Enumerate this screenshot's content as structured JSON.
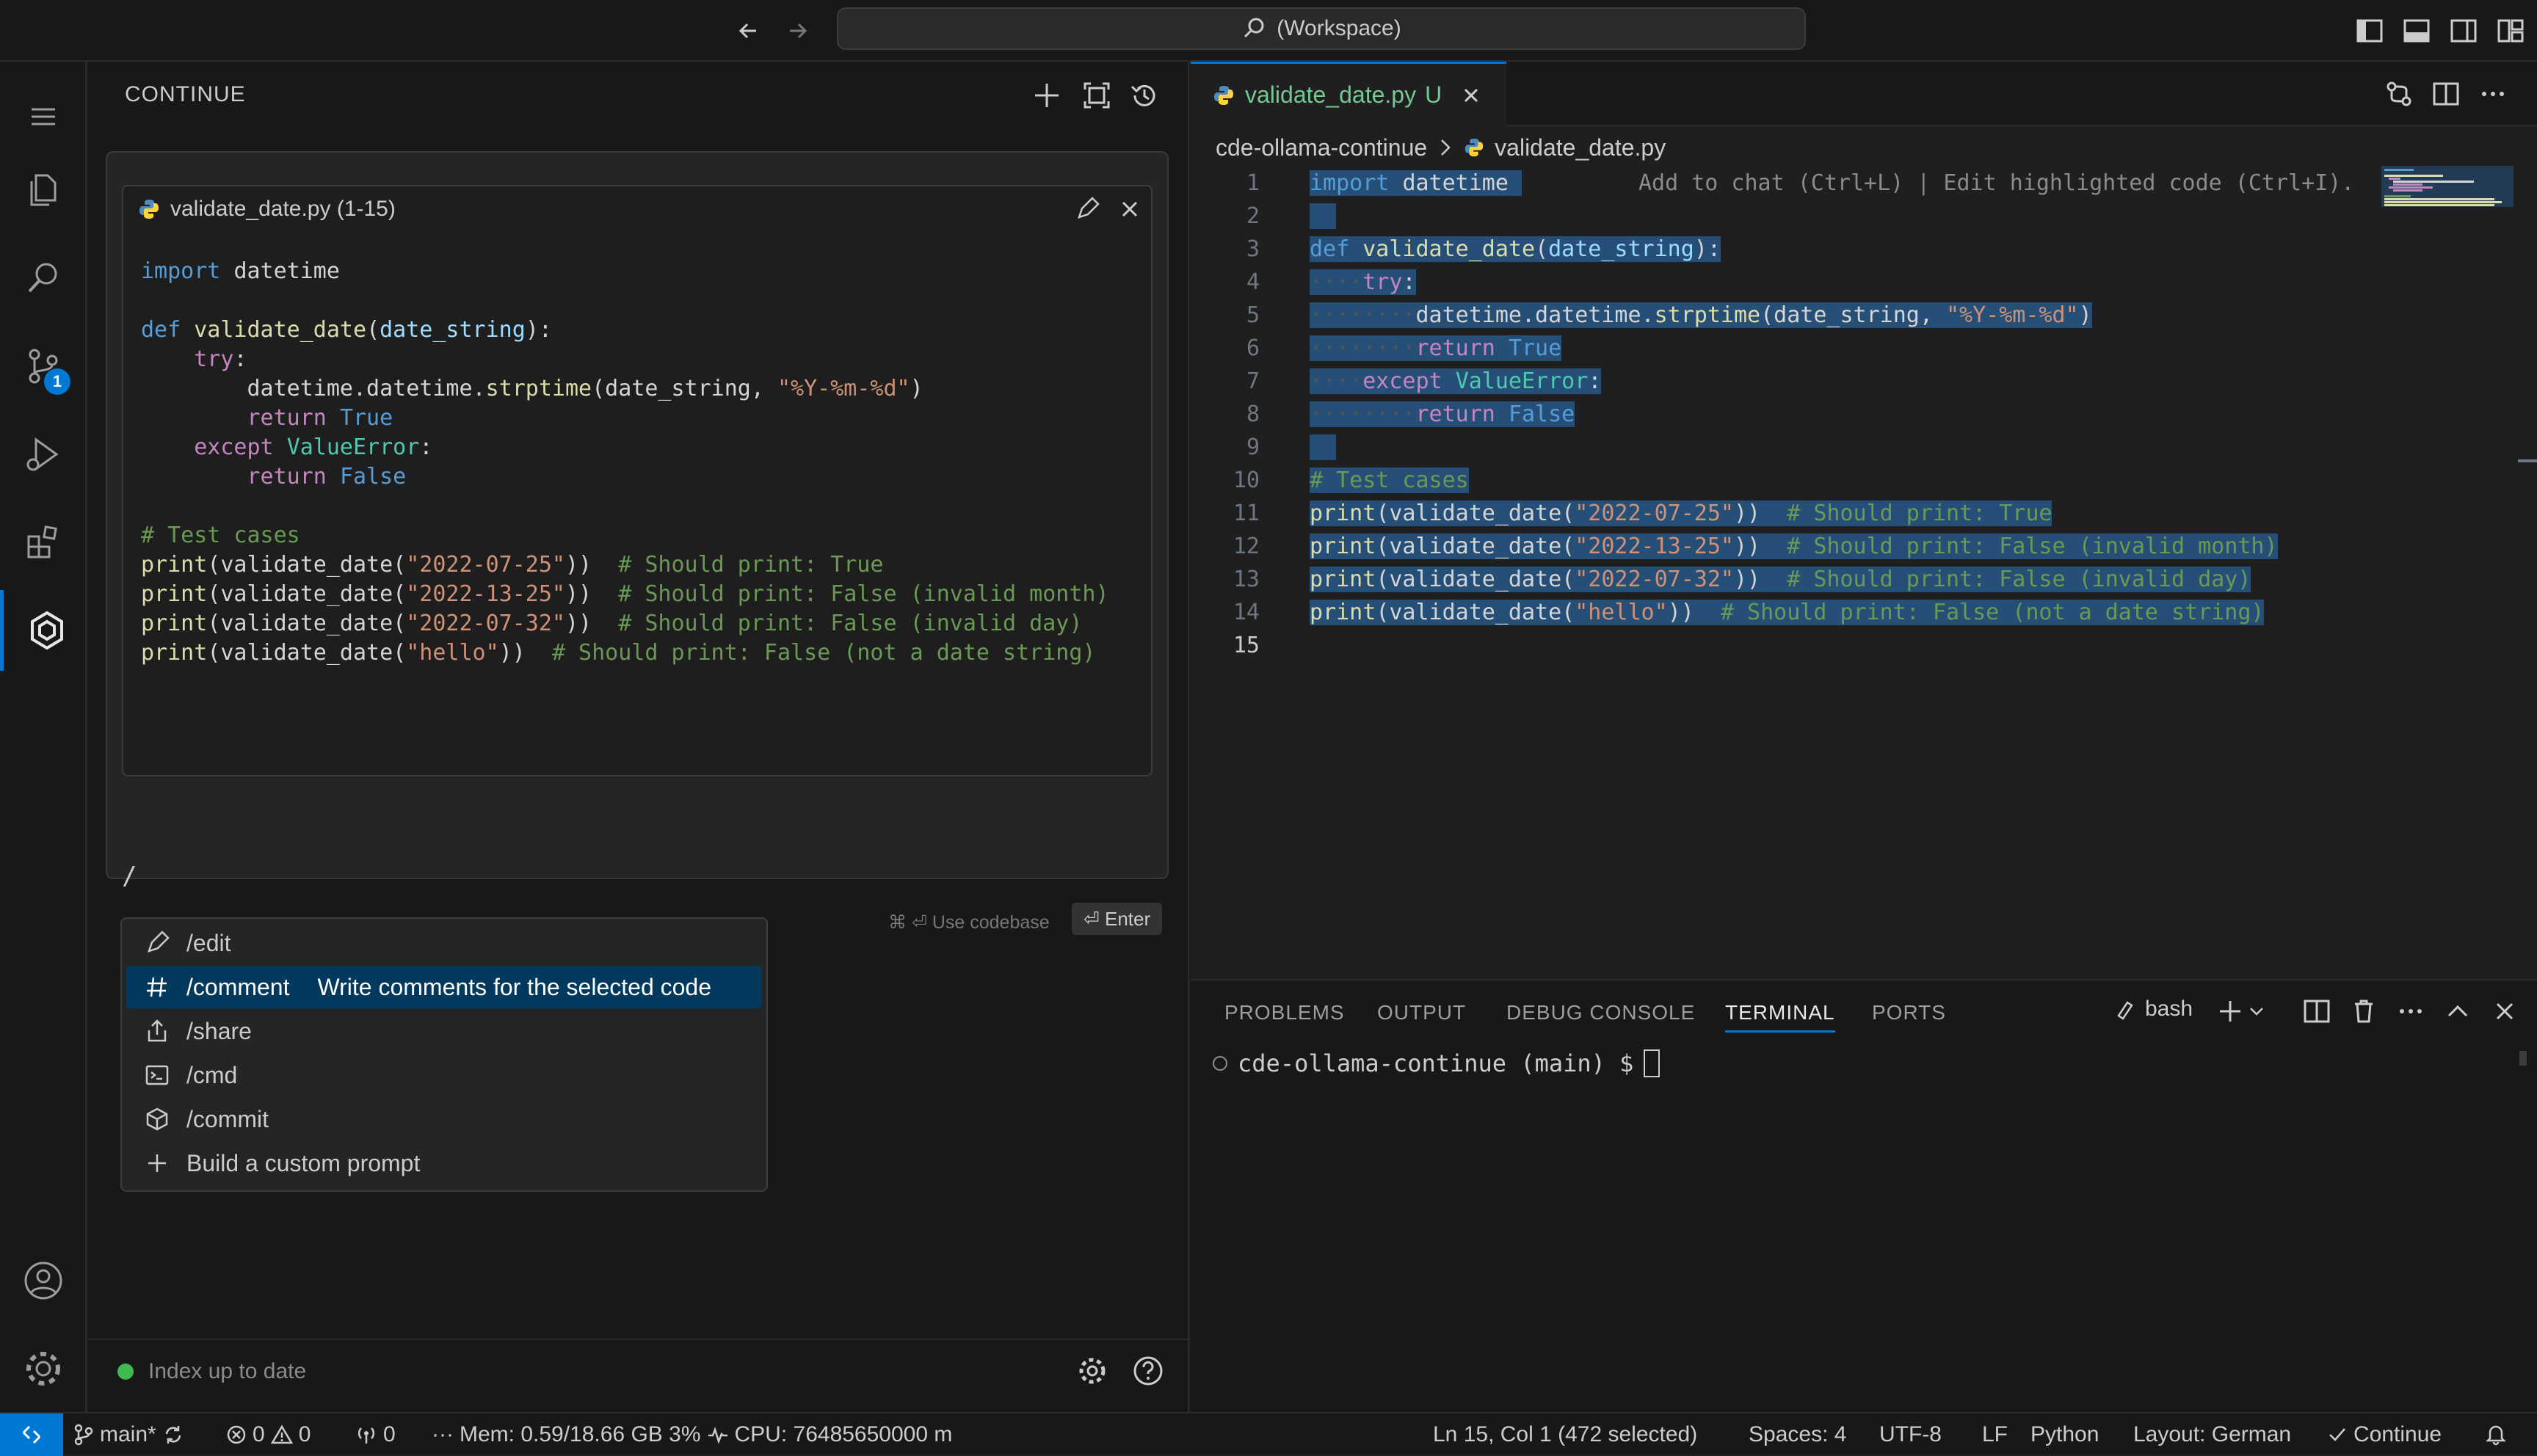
{
  "titlebar": {
    "search": "(Workspace)"
  },
  "activity": {
    "source_control_badge": "1"
  },
  "continue_panel": {
    "title": "CONTINUE",
    "context_file": "validate_date.py (1-15)",
    "typed_input": "/",
    "hint_codebase": "⌘ ⏎ Use codebase",
    "enter_label": "⏎ Enter",
    "slash_menu": [
      {
        "label": "/edit",
        "icon": "pencil-icon"
      },
      {
        "label": "/comment",
        "icon": "hash-icon",
        "description": "Write comments for the selected code"
      },
      {
        "label": "/share",
        "icon": "share-icon"
      },
      {
        "label": "/cmd",
        "icon": "terminal-icon"
      },
      {
        "label": "/commit",
        "icon": "cube-icon"
      },
      {
        "label": "Build a custom prompt",
        "icon": "plus-icon"
      }
    ],
    "footer_status": "Index up to date"
  },
  "code": {
    "lines": [
      "import datetime",
      "",
      "def validate_date(date_string):",
      "    try:",
      "        datetime.datetime.strptime(date_string, \"%Y-%m-%d\")",
      "        return True",
      "    except ValueError:",
      "        return False",
      "",
      "# Test cases",
      "print(validate_date(\"2022-07-25\"))  # Should print: True",
      "print(validate_date(\"2022-13-25\"))  # Should print: False (invalid month)",
      "print(validate_date(\"2022-07-32\"))  # Should print: False (invalid day)",
      "print(validate_date(\"hello\"))  # Should print: False (not a date string)",
      ""
    ],
    "inline_hint": "Add to chat (Ctrl+L) | Edit highlighted code (Ctrl+I)."
  },
  "editor": {
    "tab_label": "validate_date.py",
    "tab_status": "U",
    "breadcrumb_folder": "cde-ollama-continue",
    "breadcrumb_file": "validate_date.py",
    "line_numbers": [
      "1",
      "2",
      "3",
      "4",
      "5",
      "6",
      "7",
      "8",
      "9",
      "10",
      "11",
      "12",
      "13",
      "14",
      "15"
    ]
  },
  "panel": {
    "tabs": [
      "PROBLEMS",
      "OUTPUT",
      "DEBUG CONSOLE",
      "TERMINAL",
      "PORTS"
    ],
    "active_tab": "TERMINAL",
    "shell": "bash",
    "prompt": "cde-ollama-continue (main) $"
  },
  "statusbar": {
    "branch": "main*",
    "errors": "0",
    "warnings": "0",
    "ports": "0",
    "mem": "Mem: 0.59/18.66 GB 3%",
    "cpu": "CPU: 76485650000 m",
    "position": "Ln 15, Col 1 (472 selected)",
    "spaces": "Spaces: 4",
    "encoding": "UTF-8",
    "eol": "LF",
    "language": "Python",
    "layout": "Layout: German",
    "continue": "Continue"
  },
  "colors": {
    "accent": "#0078d4",
    "selection": "#264f78",
    "menu_selected": "#04395e"
  }
}
